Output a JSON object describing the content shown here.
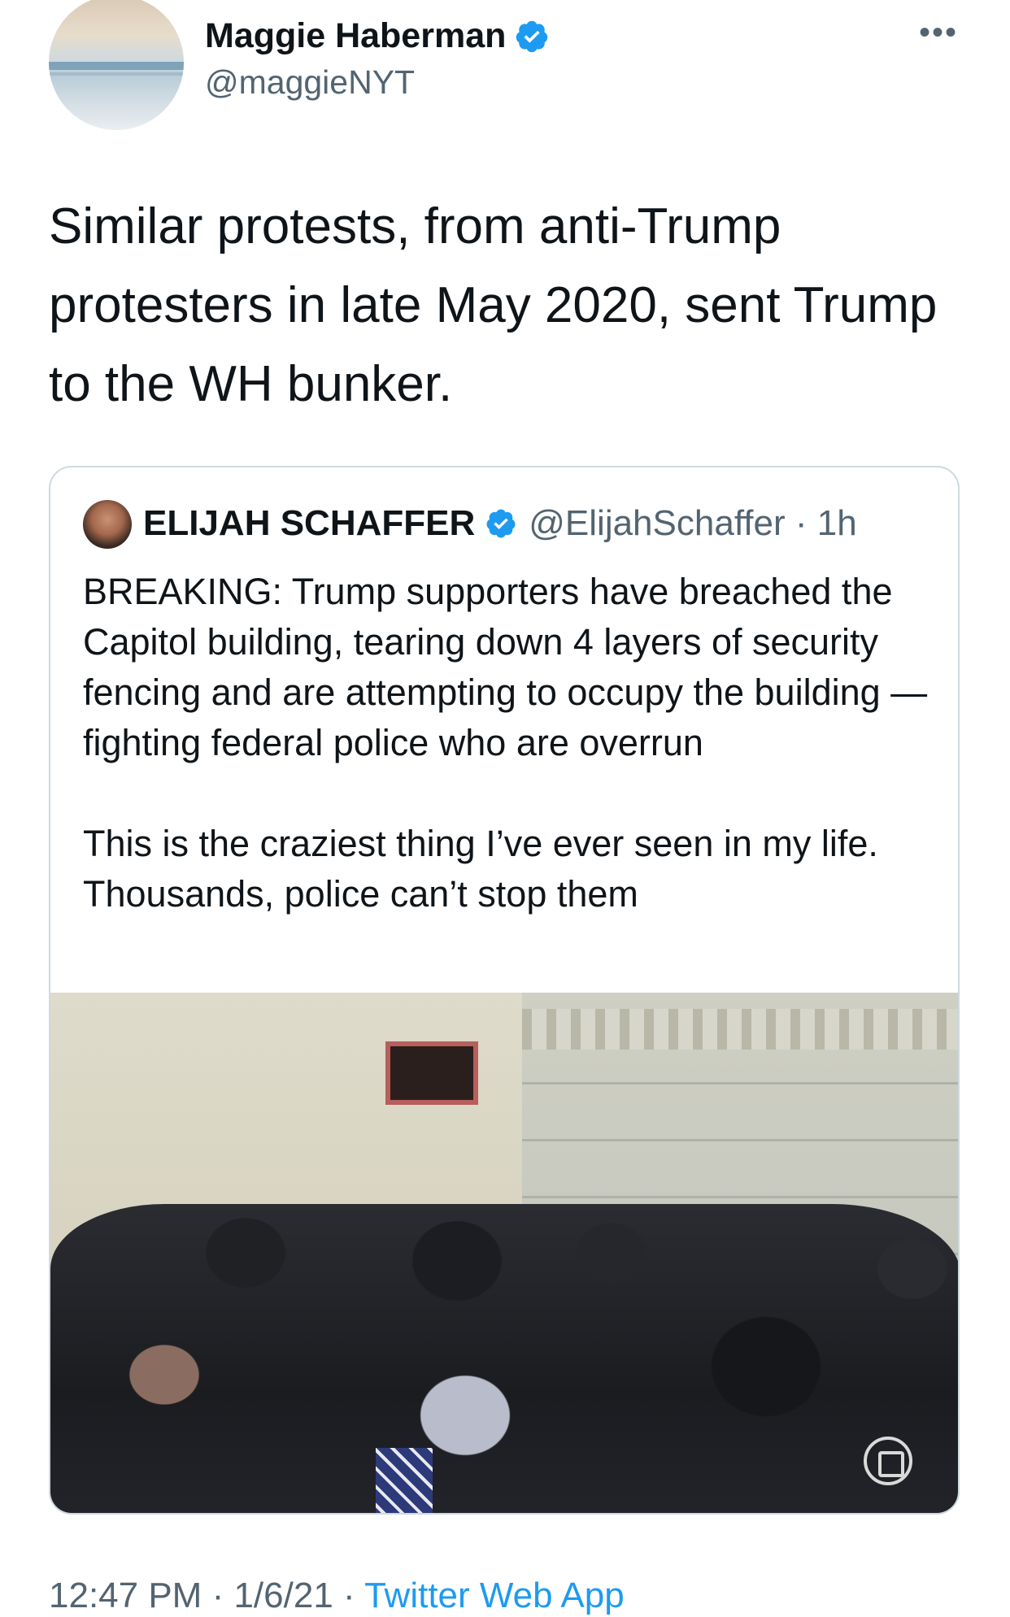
{
  "author": {
    "name": "Maggie Haberman",
    "handle": "@maggieNYT"
  },
  "tweet": {
    "text": "Similar protests, from anti-Trump protesters in late May 2020, sent Trump to the WH bunker."
  },
  "quote": {
    "name": "ELIJAH SCHAFFER",
    "handle": "@ElijahSchaffer",
    "separator": "·",
    "time": "1h",
    "text": "BREAKING: Trump supporters have breached the Capitol building, tearing down 4 layers of security fencing and are attempting to occupy the building — fighting federal police who are overrun\n\nThis is the craziest thing I’ve ever seen in my life. Thousands, police can’t stop them"
  },
  "footer": {
    "time": "12:47 PM",
    "sep1": " · ",
    "date": "1/6/21",
    "sep2": " · ",
    "app": "Twitter Web App"
  },
  "icons": {
    "verified": "verified-badge-icon",
    "more": "more-options-icon"
  },
  "colors": {
    "verified": "#1d9bf0",
    "link": "#1d9bf0",
    "secondary_text": "#536471",
    "border": "#cfd9de"
  }
}
